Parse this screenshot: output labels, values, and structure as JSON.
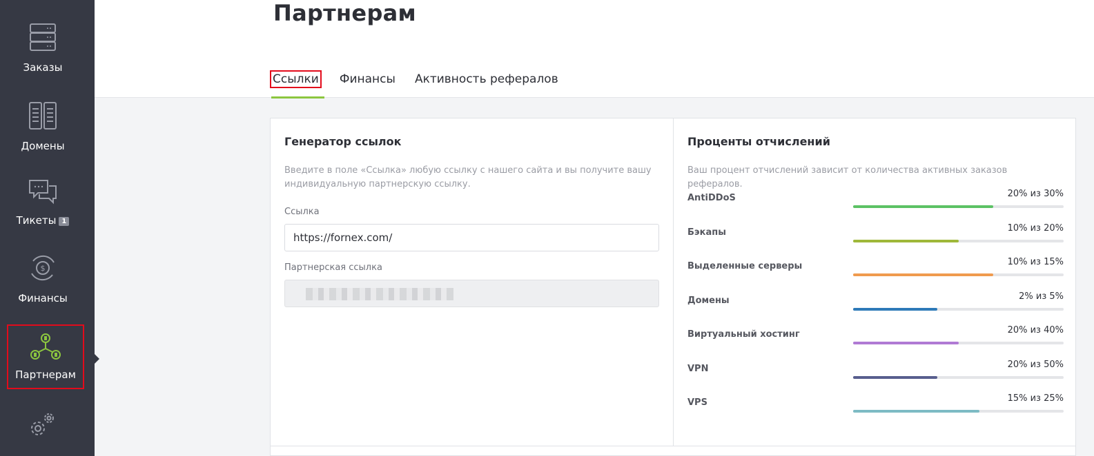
{
  "sidebar": {
    "items": [
      {
        "label": "Заказы",
        "icon": "server-icon"
      },
      {
        "label": "Домены",
        "icon": "domains-icon"
      },
      {
        "label": "Тикеты",
        "icon": "chat-icon",
        "badge": "1"
      },
      {
        "label": "Финансы",
        "icon": "finance-icon"
      },
      {
        "label": "Партнерам",
        "icon": "partners-icon",
        "active": true
      },
      {
        "label": "",
        "icon": "settings-icon"
      }
    ]
  },
  "header": {
    "title": "Партнерам",
    "tabs": [
      {
        "label": "Ссылки",
        "active": true
      },
      {
        "label": "Финансы"
      },
      {
        "label": "Активность рефералов"
      }
    ]
  },
  "generator": {
    "title": "Генератор ссылок",
    "description": "Введите в поле «Ссылка» любую ссылку с нашего сайта и вы получите вашу индивидуальную партнерскую ссылку.",
    "link_label": "Ссылка",
    "link_value": "https://fornex.com/",
    "partner_link_label": "Партнерская ссылка"
  },
  "percents": {
    "title": "Проценты отчислений",
    "description": "Ваш процент отчислений зависит от количества активных заказов рефералов.",
    "rows": [
      {
        "name": "AntiDDoS",
        "value": "20% из 30%",
        "fraction": 0.667,
        "color": "#5cc264"
      },
      {
        "name": "Бэкапы",
        "value": "10% из 20%",
        "fraction": 0.5,
        "color": "#9fb83a"
      },
      {
        "name": "Выделенные серверы",
        "value": "10% из 15%",
        "fraction": 0.667,
        "color": "#f09b4e"
      },
      {
        "name": "Домены",
        "value": "2% из 5%",
        "fraction": 0.4,
        "color": "#2d7ab8"
      },
      {
        "name": "Виртуальный хостинг",
        "value": "20% из 40%",
        "fraction": 0.5,
        "color": "#b07ad4"
      },
      {
        "name": "VPN",
        "value": "20% из 50%",
        "fraction": 0.4,
        "color": "#585e8e"
      },
      {
        "name": "VPS",
        "value": "15% из 25%",
        "fraction": 0.6,
        "color": "#7dbbc4"
      }
    ]
  },
  "colors": {
    "accent": "#8cc63f",
    "sidebar_bg": "#363944",
    "highlight": "#e30b1b"
  }
}
